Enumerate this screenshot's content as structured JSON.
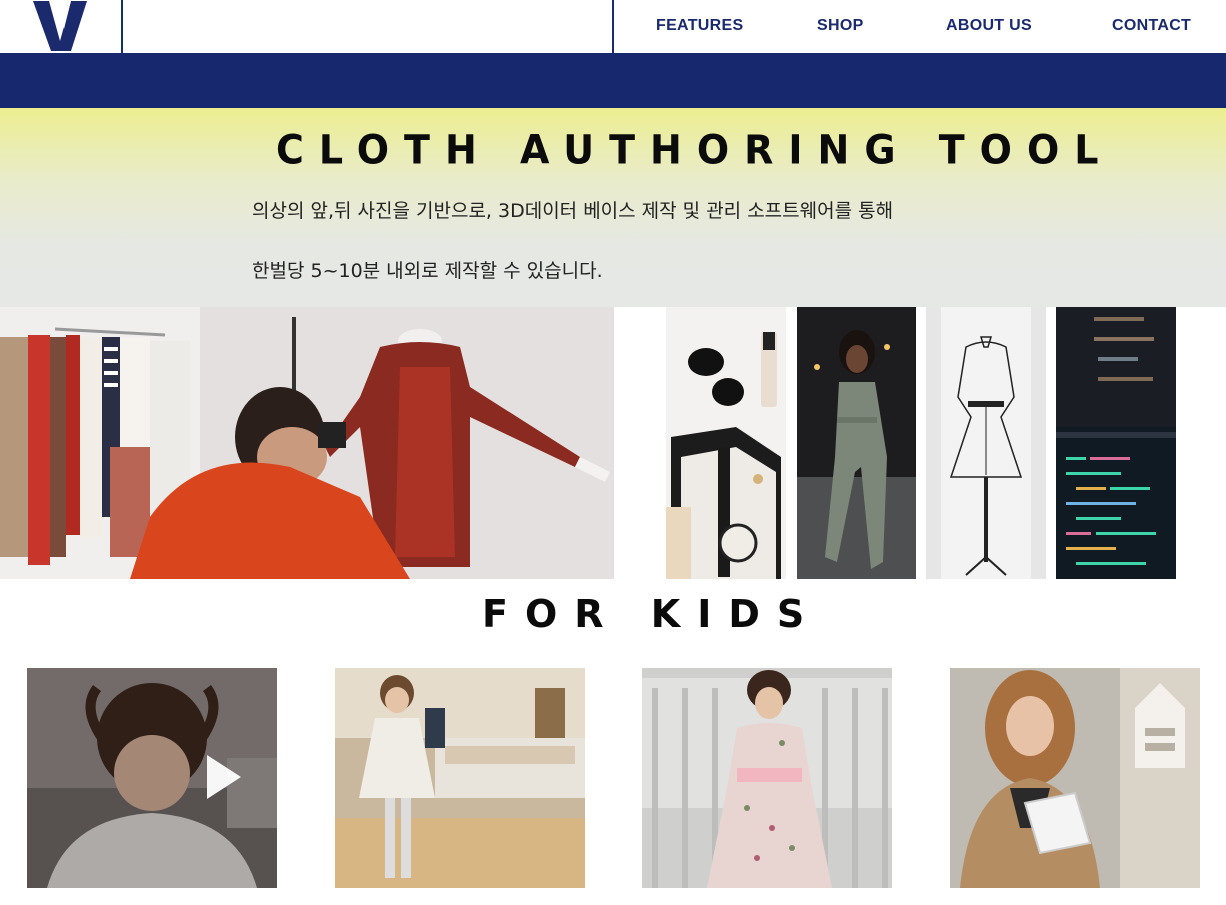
{
  "header": {
    "logo_icon": "v-logo-icon",
    "brand_color": "#1a2a6c",
    "nav": [
      {
        "label": "FEATURES"
      },
      {
        "label": "SHOP"
      },
      {
        "label": "ABOUT US"
      },
      {
        "label": "CONTACT"
      }
    ]
  },
  "band_color": "#18286e",
  "hero": {
    "title": "CLOTH AUTHORING TOOL",
    "line1": "의상의 앞,뒤 사진을 기반으로, 3D데이터 베이스 제작 및 관리 소프트웨어를 통해",
    "line2": "한벌당 5~10분 내외로 제작할 수 있습니다."
  },
  "photos": {
    "main": "photographer-mannequin-image",
    "thumbs": [
      "accessories-flatlay-image",
      "woman-jumpsuit-image",
      "dress-form-sketch-image",
      "code-screen-image"
    ]
  },
  "kids": {
    "title": "FOR KIDS",
    "videos": [
      {
        "name": "girl-hair-video",
        "icon": "play-icon"
      },
      {
        "name": "girl-store-video"
      },
      {
        "name": "girl-floral-dress-video"
      },
      {
        "name": "woman-tablet-video"
      }
    ]
  }
}
